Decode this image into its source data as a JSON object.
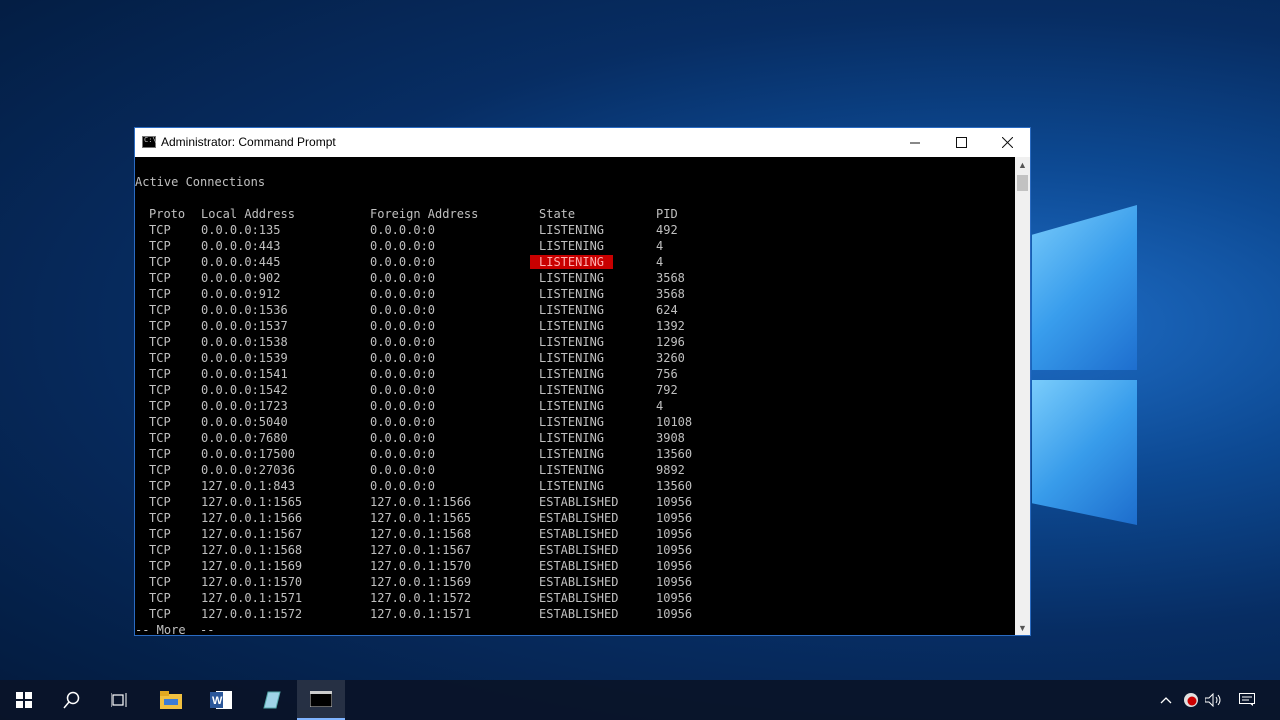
{
  "window": {
    "title": "Administrator: Command Prompt",
    "icons": {
      "minimize": "minimize-icon",
      "maximize": "maximize-icon",
      "close": "close-icon"
    }
  },
  "console": {
    "heading": "Active Connections",
    "columns": [
      "Proto",
      "Local Address",
      "Foreign Address",
      "State",
      "PID"
    ],
    "rows": [
      [
        "TCP",
        "0.0.0.0:135",
        "0.0.0.0:0",
        "LISTENING",
        "492"
      ],
      [
        "TCP",
        "0.0.0.0:443",
        "0.0.0.0:0",
        "LISTENING",
        "4"
      ],
      [
        "TCP",
        "0.0.0.0:445",
        "0.0.0.0:0",
        "LISTENING",
        "4"
      ],
      [
        "TCP",
        "0.0.0.0:902",
        "0.0.0.0:0",
        "LISTENING",
        "3568"
      ],
      [
        "TCP",
        "0.0.0.0:912",
        "0.0.0.0:0",
        "LISTENING",
        "3568"
      ],
      [
        "TCP",
        "0.0.0.0:1536",
        "0.0.0.0:0",
        "LISTENING",
        "624"
      ],
      [
        "TCP",
        "0.0.0.0:1537",
        "0.0.0.0:0",
        "LISTENING",
        "1392"
      ],
      [
        "TCP",
        "0.0.0.0:1538",
        "0.0.0.0:0",
        "LISTENING",
        "1296"
      ],
      [
        "TCP",
        "0.0.0.0:1539",
        "0.0.0.0:0",
        "LISTENING",
        "3260"
      ],
      [
        "TCP",
        "0.0.0.0:1541",
        "0.0.0.0:0",
        "LISTENING",
        "756"
      ],
      [
        "TCP",
        "0.0.0.0:1542",
        "0.0.0.0:0",
        "LISTENING",
        "792"
      ],
      [
        "TCP",
        "0.0.0.0:1723",
        "0.0.0.0:0",
        "LISTENING",
        "4"
      ],
      [
        "TCP",
        "0.0.0.0:5040",
        "0.0.0.0:0",
        "LISTENING",
        "10108"
      ],
      [
        "TCP",
        "0.0.0.0:7680",
        "0.0.0.0:0",
        "LISTENING",
        "3908"
      ],
      [
        "TCP",
        "0.0.0.0:17500",
        "0.0.0.0:0",
        "LISTENING",
        "13560"
      ],
      [
        "TCP",
        "0.0.0.0:27036",
        "0.0.0.0:0",
        "LISTENING",
        "9892"
      ],
      [
        "TCP",
        "127.0.0.1:843",
        "0.0.0.0:0",
        "LISTENING",
        "13560"
      ],
      [
        "TCP",
        "127.0.0.1:1565",
        "127.0.0.1:1566",
        "ESTABLISHED",
        "10956"
      ],
      [
        "TCP",
        "127.0.0.1:1566",
        "127.0.0.1:1565",
        "ESTABLISHED",
        "10956"
      ],
      [
        "TCP",
        "127.0.0.1:1567",
        "127.0.0.1:1568",
        "ESTABLISHED",
        "10956"
      ],
      [
        "TCP",
        "127.0.0.1:1568",
        "127.0.0.1:1567",
        "ESTABLISHED",
        "10956"
      ],
      [
        "TCP",
        "127.0.0.1:1569",
        "127.0.0.1:1570",
        "ESTABLISHED",
        "10956"
      ],
      [
        "TCP",
        "127.0.0.1:1570",
        "127.0.0.1:1569",
        "ESTABLISHED",
        "10956"
      ],
      [
        "TCP",
        "127.0.0.1:1571",
        "127.0.0.1:1572",
        "ESTABLISHED",
        "10956"
      ],
      [
        "TCP",
        "127.0.0.1:1572",
        "127.0.0.1:1571",
        "ESTABLISHED",
        "10956"
      ]
    ],
    "highlighted_row": 2,
    "more_prompt": "-- More  --"
  },
  "taskbar": {
    "items": [
      {
        "name": "start",
        "icon": "windows-icon"
      },
      {
        "name": "search",
        "icon": "search-icon"
      },
      {
        "name": "task-view",
        "icon": "task-view-icon"
      },
      {
        "name": "file-explorer",
        "icon": "folder-icon"
      },
      {
        "name": "word",
        "icon": "word-icon"
      },
      {
        "name": "app",
        "icon": "app-icon"
      },
      {
        "name": "command-prompt",
        "icon": "cmd-icon",
        "active": true
      }
    ],
    "tray": [
      "chevron-up-icon",
      "security-icon",
      "volume-icon",
      "notification-icon"
    ]
  },
  "colors": {
    "highlight": "#c80000",
    "console_bg": "#000000",
    "console_fg": "#c0c0c0",
    "accent": "#2a6bc2"
  }
}
